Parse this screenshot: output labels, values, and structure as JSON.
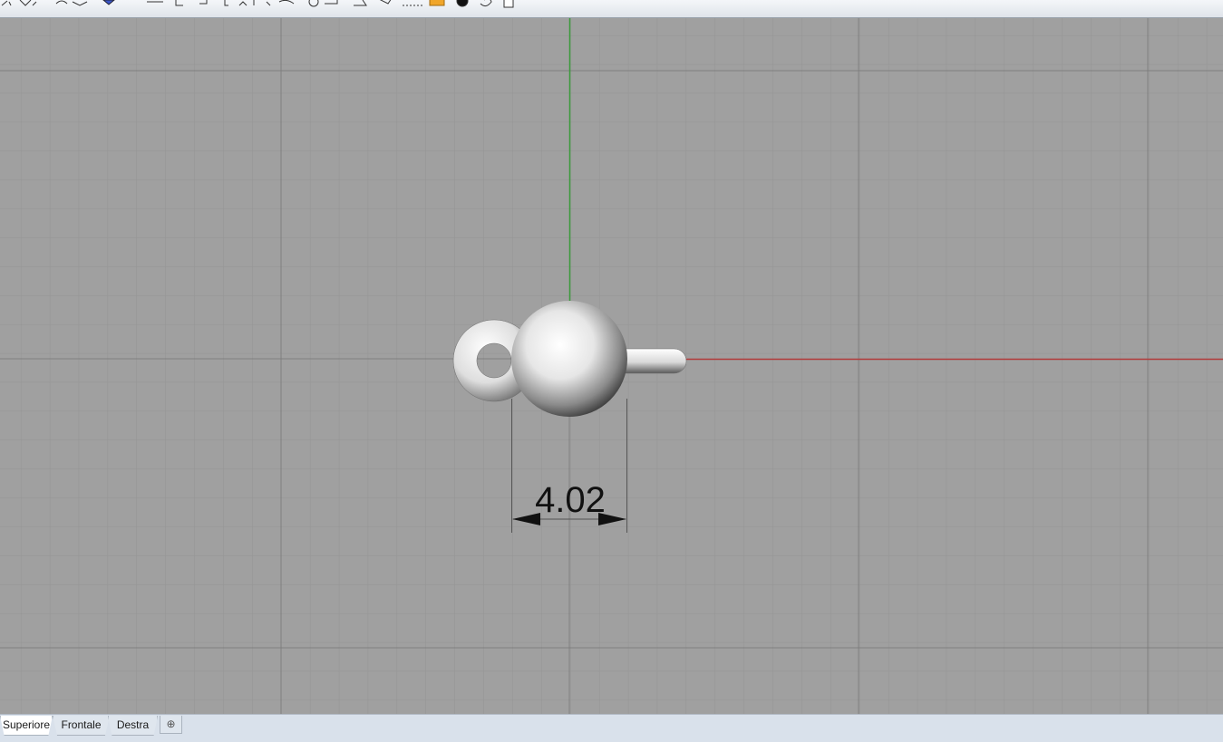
{
  "toolbar": {
    "icons": [
      "polyline-icon",
      "dimension-icon",
      "curve-tools-icon",
      "gumball-icon",
      "text-icon",
      "transform-icon",
      "array-icon",
      "align-icon",
      "surface-icon",
      "hatch-icon",
      "layout-icon",
      "solid-icon",
      "dotted-line-icon",
      "folder-icon",
      "render-material-icon",
      "spiral-icon",
      "page-icon"
    ]
  },
  "viewport": {
    "active_view": "Superiore",
    "background_color": "#a0a0a0",
    "x_axis_color": "#b23a3a",
    "y_axis_color": "#3a9a3a",
    "dimension": {
      "label": "4.02"
    }
  },
  "tabs": {
    "items": [
      {
        "label": "Superiore",
        "active": true
      },
      {
        "label": "Frontale",
        "active": false
      },
      {
        "label": "Destra",
        "active": false
      }
    ],
    "add_label": "⊕"
  }
}
